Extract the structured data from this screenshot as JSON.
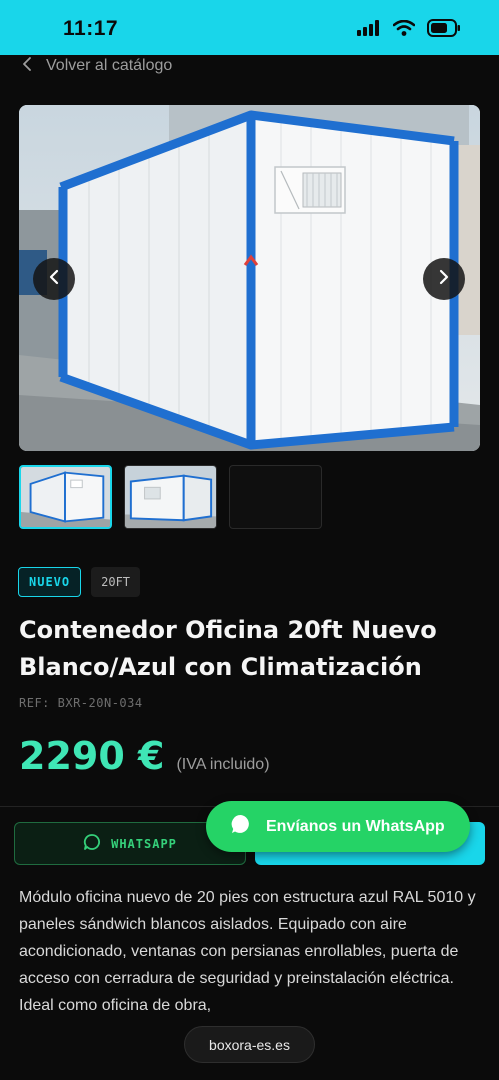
{
  "status_bar": {
    "time": "11:17",
    "icons": [
      "signal-icon",
      "wifi-icon",
      "battery-icon"
    ]
  },
  "nav": {
    "back_label": "Volver al catálogo"
  },
  "gallery": {
    "main_image": "container-photo",
    "prev_icon": "chevron-left-icon",
    "next_icon": "chevron-right-icon",
    "thumbnails": [
      "container-photo-1",
      "container-photo-2",
      "empty-thumbnail"
    ]
  },
  "product": {
    "badges": [
      "NUEVO",
      "20FT"
    ],
    "title": "Contenedor Oficina 20ft Nuevo Blanco/Azul con Climatización",
    "ref": "REF: BXR-20N-034",
    "price": "2290 €",
    "price_note": "(IVA incluido)",
    "description": "Módulo oficina nuevo de 20 pies con estructura azul RAL 5010 y paneles sándwich blancos aislados. Equipado con aire acondicionado, ventanas con persianas enrollables, puerta de acceso con cerradura de seguridad y preinstalación eléctrica. Ideal como oficina de obra,"
  },
  "actions": {
    "whatsapp_label": "WHATSAPP",
    "floating_whatsapp_label": "Envíanos un WhatsApp"
  },
  "browser": {
    "url": "boxora-es.es"
  },
  "colors": {
    "accent": "#19d6ea",
    "price": "#3fe6b5",
    "whatsapp": "#25d366",
    "background": "#0b0b0b"
  }
}
